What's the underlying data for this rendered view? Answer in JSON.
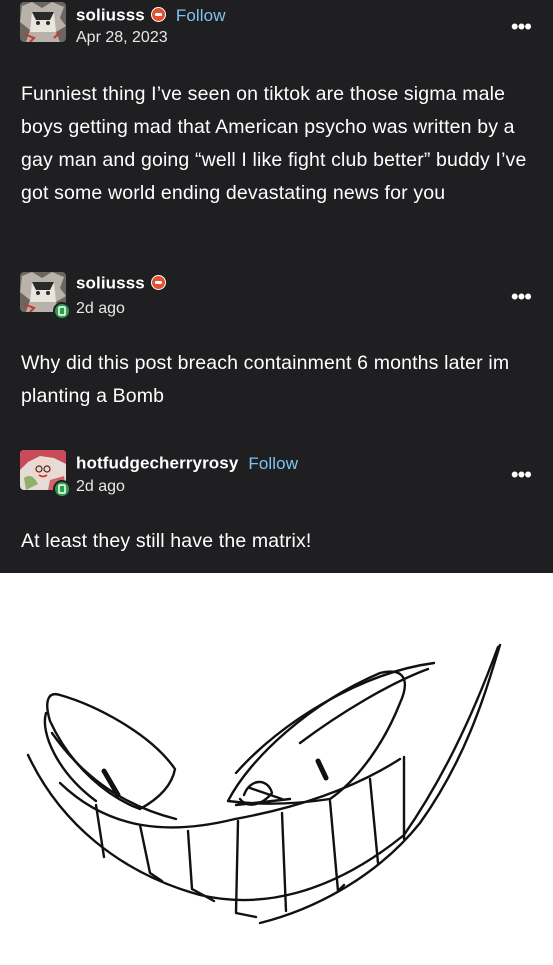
{
  "posts": [
    {
      "username": "soliusss",
      "follow_label": "Follow",
      "date": "Apr 28, 2023",
      "more": "•••",
      "text": "Funniest thing I’ve seen on tiktok are those sigma male boys getting mad that American psycho was written by a gay man and going “well I like fight club better” buddy I’ve got some world ending devastating news for you"
    },
    {
      "username": "soliusss",
      "date": "2d ago",
      "more": "•••",
      "text": "Why did this post breach containment 6 months later im planting a Bomb"
    },
    {
      "username": "hotfudgecherryrosy",
      "follow_label": "Follow",
      "date": "2d ago",
      "more": "•••",
      "text": "At least they still have the matrix!"
    }
  ],
  "colors": {
    "background": "#1f1f21",
    "follow": "#7ec3f3",
    "verified_badge": "#e4502d",
    "online_badge": "#2e9e4e"
  },
  "icons": [
    "avatar-image",
    "verified-badge-icon",
    "online-badge-icon",
    "more-options-icon"
  ],
  "image": "hand-drawn grinning face sketch"
}
